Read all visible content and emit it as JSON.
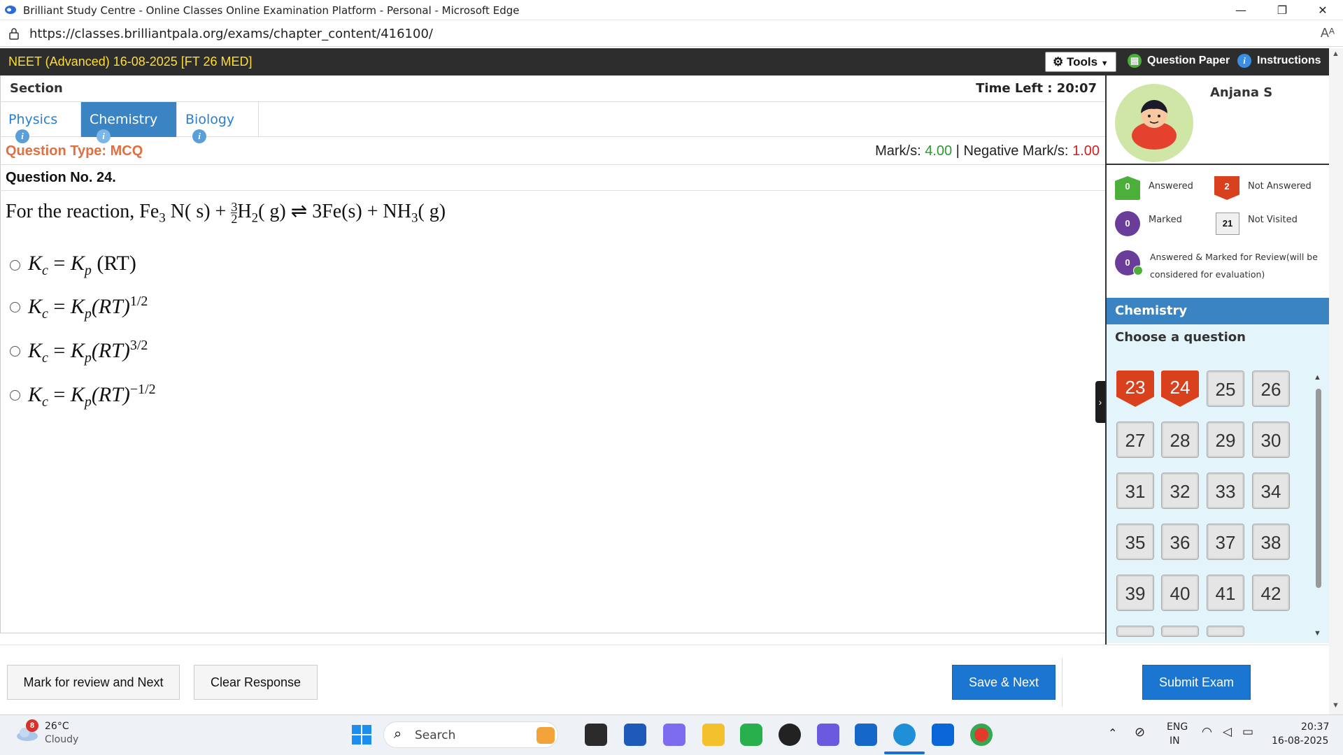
{
  "window": {
    "title": "Brilliant Study Centre - Online Classes Online Examination Platform - Personal - Microsoft Edge",
    "minimize": "—",
    "restore": "❐",
    "close": "✕"
  },
  "address": {
    "url": "https://classes.brilliantpala.org/exams/chapter_content/416100/",
    "read_aloud": "Aᴬ"
  },
  "exam": {
    "title": "NEET (Advanced) 16-08-2025 [FT 26 MED]",
    "tools_label": "Tools",
    "question_paper_label": "Question Paper",
    "instructions_label": "Instructions"
  },
  "section": {
    "label": "Section",
    "time_left_label": "Time Left :",
    "time_left_value": "20:07"
  },
  "tabs": [
    {
      "label": "Physics",
      "active": false
    },
    {
      "label": "Chemistry",
      "active": true
    },
    {
      "label": "Biology",
      "active": false
    }
  ],
  "question": {
    "type_label": "Question Type: MCQ",
    "marks_label": "Mark/s:",
    "marks_value": "4.00",
    "neg_label": "Negative Mark/s:",
    "neg_value": "1.00",
    "number": "Question No. 24.",
    "text_prefix": "For the reaction, ",
    "options": [
      {
        "lhs": "K",
        "lhs_sub": "c",
        "eq": " = ",
        "rhs": "K",
        "rhs_sub": "p",
        "tail": " (RT)",
        "exp": ""
      },
      {
        "lhs": "K",
        "lhs_sub": "c",
        "eq": " = ",
        "rhs": "K",
        "rhs_sub": "p",
        "tail": "(RT)",
        "exp": "1/2"
      },
      {
        "lhs": "K",
        "lhs_sub": "c",
        "eq": " = ",
        "rhs": "K",
        "rhs_sub": "p",
        "tail": "(RT)",
        "exp": "3/2"
      },
      {
        "lhs": "K",
        "lhs_sub": "c",
        "eq": " = ",
        "rhs": "K",
        "rhs_sub": "p",
        "tail": "(RT)",
        "exp": "−1/2"
      }
    ]
  },
  "buttons": {
    "mark_review": "Mark for review and Next",
    "clear": "Clear Response",
    "save_next": "Save & Next",
    "submit": "Submit Exam"
  },
  "panel": {
    "user_name": "Anjana S",
    "legend": {
      "answered": {
        "count": "0",
        "label": "Answered"
      },
      "not_answered": {
        "count": "2",
        "label": "Not Answered"
      },
      "marked": {
        "count": "0",
        "label": "Marked"
      },
      "not_visited": {
        "count": "21",
        "label": "Not Visited"
      },
      "answered_marked": {
        "count": "0",
        "label_line1": "Answered & Marked for Review(will be",
        "label_line2": "considered for evaluation)"
      }
    },
    "subject": "Chemistry",
    "choose_label": "Choose a question",
    "questions": [
      {
        "n": "23",
        "status": "not_answered"
      },
      {
        "n": "24",
        "status": "not_answered"
      },
      {
        "n": "25",
        "status": "not_visited"
      },
      {
        "n": "26",
        "status": "not_visited"
      },
      {
        "n": "27",
        "status": "not_visited"
      },
      {
        "n": "28",
        "status": "not_visited"
      },
      {
        "n": "29",
        "status": "not_visited"
      },
      {
        "n": "30",
        "status": "not_visited"
      },
      {
        "n": "31",
        "status": "not_visited"
      },
      {
        "n": "32",
        "status": "not_visited"
      },
      {
        "n": "33",
        "status": "not_visited"
      },
      {
        "n": "34",
        "status": "not_visited"
      },
      {
        "n": "35",
        "status": "not_visited"
      },
      {
        "n": "36",
        "status": "not_visited"
      },
      {
        "n": "37",
        "status": "not_visited"
      },
      {
        "n": "38",
        "status": "not_visited"
      },
      {
        "n": "39",
        "status": "not_visited"
      },
      {
        "n": "40",
        "status": "not_visited"
      },
      {
        "n": "41",
        "status": "not_visited"
      },
      {
        "n": "42",
        "status": "not_visited"
      }
    ]
  },
  "taskbar": {
    "weather_badge": "8",
    "temperature": "26°C",
    "condition": "Cloudy",
    "search_placeholder": "Search",
    "lang_line1": "ENG",
    "lang_line2": "IN",
    "time": "20:37",
    "date": "16-08-2025"
  },
  "colors": {
    "exam_header_bg": "#2d2d2d",
    "exam_title": "#ffdd33",
    "accent_blue": "#3a84c4",
    "answered_green": "#4caf3a",
    "not_answered_red": "#d9411e",
    "marked_purple": "#6a3d9a",
    "marks_positive": "#2e9a2e",
    "marks_negative": "#d32020",
    "qtype_orange": "#e07040"
  }
}
